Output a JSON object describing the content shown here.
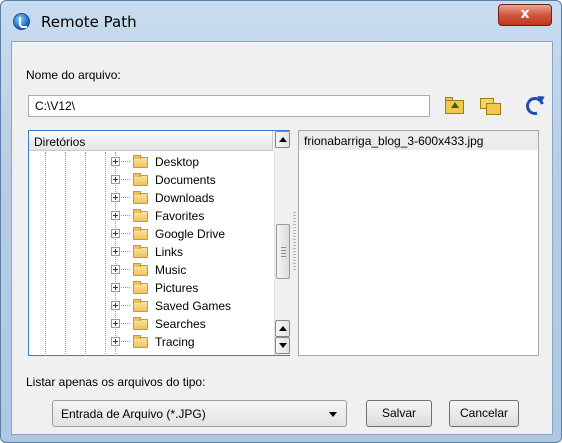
{
  "window": {
    "title": "Remote Path",
    "close_label": "x"
  },
  "file_name": {
    "label": "Nome do arquivo:",
    "value": "C:\\V12\\"
  },
  "toolbar": {
    "icons": [
      "folder-up-icon",
      "new-folder-icon",
      "refresh-icon"
    ]
  },
  "tree": {
    "header": "Diretórios",
    "items": [
      {
        "label": "Desktop"
      },
      {
        "label": "Documents"
      },
      {
        "label": "Downloads"
      },
      {
        "label": "Favorites"
      },
      {
        "label": "Google Drive"
      },
      {
        "label": "Links"
      },
      {
        "label": "Music"
      },
      {
        "label": "Pictures"
      },
      {
        "label": "Saved Games"
      },
      {
        "label": "Searches"
      },
      {
        "label": "Tracing"
      }
    ]
  },
  "files": {
    "items": [
      {
        "label": "frionabarriga_blog_3-600x433.jpg",
        "selected": true
      }
    ]
  },
  "filter": {
    "label": "Listar apenas os arquivos do tipo:",
    "value": "Entrada de Arquivo (*.JPG)"
  },
  "buttons": {
    "save": "Salvar",
    "cancel": "Cancelar"
  },
  "colors": {
    "accent": "#3b7bd0",
    "close": "#c0361d"
  }
}
